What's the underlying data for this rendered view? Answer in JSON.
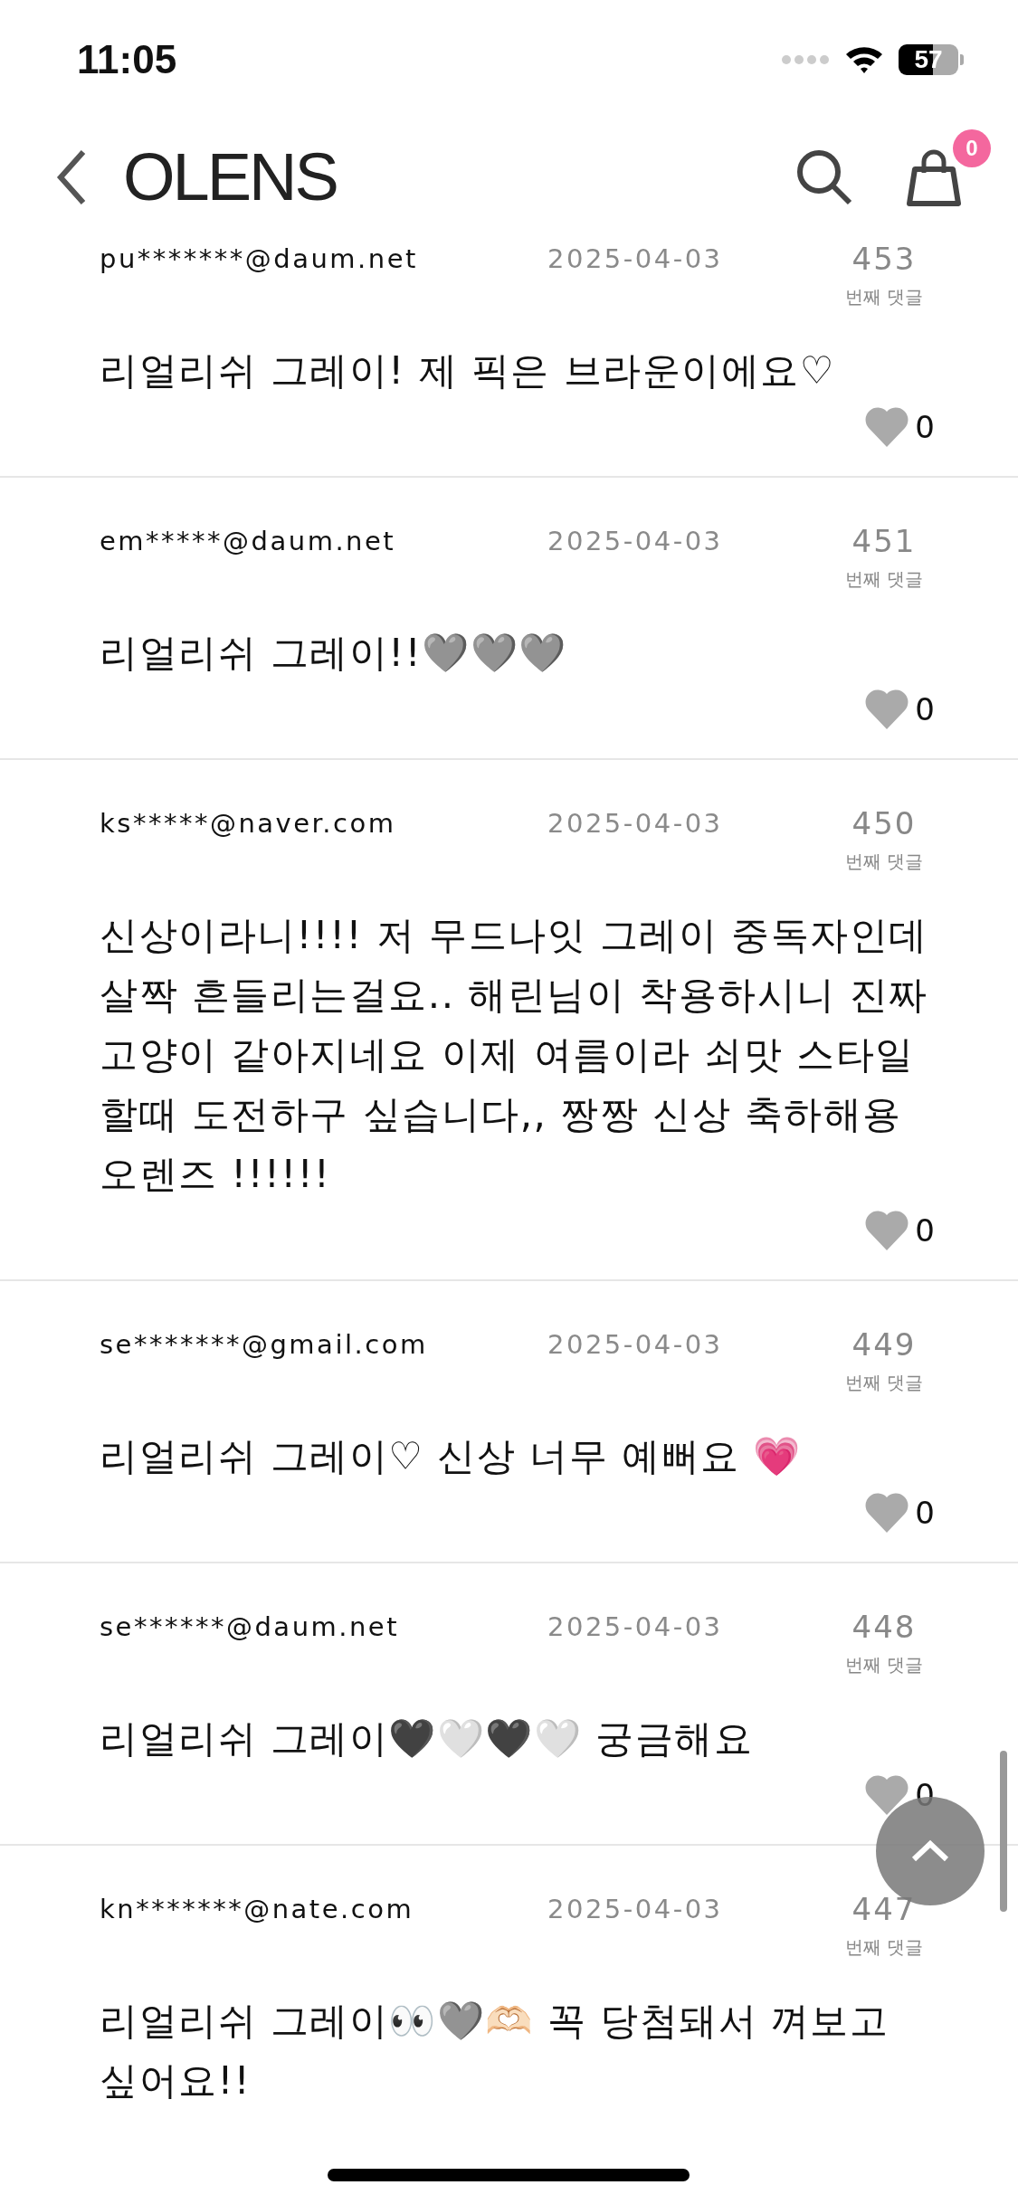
{
  "status_bar": {
    "time": "11:05",
    "battery": "57"
  },
  "header": {
    "logo": "OLENS",
    "cart_count": "0"
  },
  "comments": [
    {
      "author": "pu*******@daum.net",
      "date": "2025-04-03",
      "number": "453",
      "number_label": "번째 댓글",
      "text": "리얼리쉬 그레이! 제 픽은 브라운이에요♡",
      "likes": "0"
    },
    {
      "author": "em*****@daum.net",
      "date": "2025-04-03",
      "number": "451",
      "number_label": "번째 댓글",
      "text": "리얼리쉬 그레이!!🩶🩶🩶",
      "likes": "0"
    },
    {
      "author": "ks*****@naver.com",
      "date": "2025-04-03",
      "number": "450",
      "number_label": "번째 댓글",
      "text": "신상이라니!!!! 저 무드나잇 그레이 중독자인데 살짝 흔들리는걸요.. 해린님이 착용하시니 진짜 고양이 같아지네요 이제 여름이라 쇠맛 스타일 할때 도전하구 싶습니다,, 짱짱 신상 축하해용 오렌즈 !!!!!!",
      "likes": "0"
    },
    {
      "author": "se*******@gmail.com",
      "date": "2025-04-03",
      "number": "449",
      "number_label": "번째 댓글",
      "text": "리얼리쉬 그레이♡ 신상 너무 예뻐요 💗",
      "likes": "0"
    },
    {
      "author": "se******@daum.net",
      "date": "2025-04-03",
      "number": "448",
      "number_label": "번째 댓글",
      "text": "리얼리쉬 그레이🖤🤍🖤🤍 궁금해요",
      "likes": "0"
    },
    {
      "author": "kn*******@nate.com",
      "date": "2025-04-03",
      "number": "447",
      "number_label": "번째 댓글",
      "text": "리얼리쉬 그레이👀🩶🫶🏻 꼭 당첨돼서 껴보고 싶어요!!"
    }
  ]
}
